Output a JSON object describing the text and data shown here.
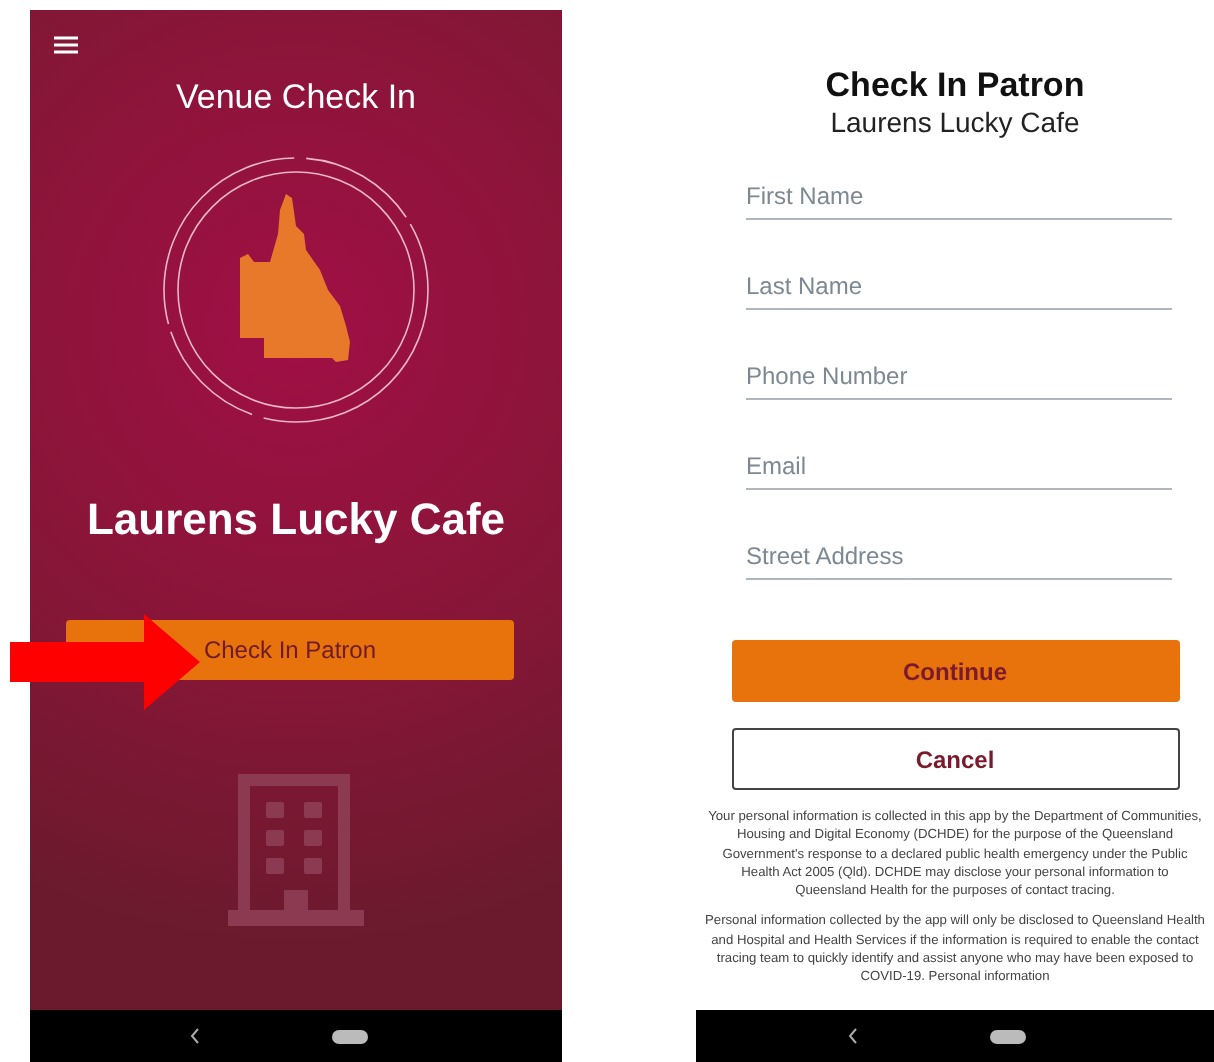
{
  "venue_screen": {
    "title": "Venue Check In",
    "venue_name": "Laurens Lucky Cafe",
    "button": "Check In Patron"
  },
  "patron_form": {
    "title": "Check In Patron",
    "subtitle": "Laurens Lucky Cafe",
    "fields": [
      {
        "placeholder": "First Name"
      },
      {
        "placeholder": "Last Name"
      },
      {
        "placeholder": "Phone Number"
      },
      {
        "placeholder": "Email"
      },
      {
        "placeholder": "Street Address"
      }
    ],
    "buttons": [
      {
        "label": "Continue",
        "kind": "primary"
      },
      {
        "label": "Cancel",
        "kind": "outline"
      }
    ],
    "notice": [
      "Your personal information is collected in this app by the Department of Communities, Housing and Digital Economy (DCHDE) for the purpose of the Queensland Government's response to a declared public health emergency under the Public Health Act 2005 (Qld).  DCHDE may disclose your personal information to Queensland Health for the purposes of contact tracing.",
      "Personal information collected by the app will only be disclosed to Queensland Health and Hospital and Health Services if the information is required to enable the contact tracing team to quickly identify and assist anyone who may have been exposed to COVID-19. Personal information"
    ]
  }
}
